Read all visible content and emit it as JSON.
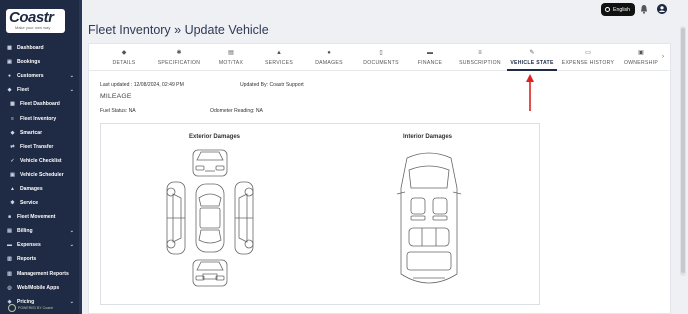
{
  "brand": {
    "logo": "Coastr",
    "tagline": "Make your own way",
    "powered_by": "POWERED BY Coastr"
  },
  "topbar": {
    "language_label": "English"
  },
  "sidebar": {
    "items": [
      {
        "label": "Dashboard",
        "icon": "dashboard-icon",
        "sub": false,
        "chevron": false
      },
      {
        "label": "Bookings",
        "icon": "calendar-icon",
        "sub": false,
        "chevron": false
      },
      {
        "label": "Customers",
        "icon": "users-icon",
        "sub": false,
        "chevron": true
      },
      {
        "label": "Fleet",
        "icon": "car-icon",
        "sub": false,
        "chevron": true
      },
      {
        "label": "Fleet Dashboard",
        "icon": "dashboard-icon",
        "sub": true,
        "chevron": false
      },
      {
        "label": "Fleet Inventory",
        "icon": "list-icon",
        "sub": true,
        "chevron": false
      },
      {
        "label": "Smartcar",
        "icon": "car-icon",
        "sub": true,
        "chevron": false
      },
      {
        "label": "Fleet Transfer",
        "icon": "transfer-icon",
        "sub": true,
        "chevron": false
      },
      {
        "label": "Vehicle Checklist",
        "icon": "check-icon",
        "sub": true,
        "chevron": false
      },
      {
        "label": "Vehicle Scheduler",
        "icon": "calendar-icon",
        "sub": true,
        "chevron": false
      },
      {
        "label": "Damages",
        "icon": "warning-icon",
        "sub": true,
        "chevron": false
      },
      {
        "label": "Service",
        "icon": "wrench-icon",
        "sub": true,
        "chevron": false
      },
      {
        "label": "Fleet Movement",
        "icon": "truck-icon",
        "sub": false,
        "chevron": false
      },
      {
        "label": "Billing",
        "icon": "billing-icon",
        "sub": false,
        "chevron": true
      },
      {
        "label": "Expenses",
        "icon": "wallet-icon",
        "sub": false,
        "chevron": true
      },
      {
        "label": "Reports",
        "icon": "report-icon",
        "sub": false,
        "chevron": false
      },
      {
        "label": "Management Reports",
        "icon": "report-icon",
        "sub": false,
        "chevron": false
      },
      {
        "label": "Web/Mobile Apps",
        "icon": "globe-icon",
        "sub": false,
        "chevron": false
      },
      {
        "label": "Pricing",
        "icon": "tag-icon",
        "sub": false,
        "chevron": true
      }
    ]
  },
  "page": {
    "title": "Fleet Inventory » Update Vehicle"
  },
  "tabs": [
    {
      "label": "DETAILS",
      "icon": "car-icon",
      "active": false
    },
    {
      "label": "SPECIFICATION",
      "icon": "wrench-icon",
      "active": false
    },
    {
      "label": "MOT/TAX",
      "icon": "document-icon",
      "active": false
    },
    {
      "label": "SERVICES",
      "icon": "warning-icon",
      "active": false
    },
    {
      "label": "DAMAGES",
      "icon": "info-icon",
      "active": false
    },
    {
      "label": "DOCUMENTS",
      "icon": "file-icon",
      "active": false
    },
    {
      "label": "FINANCE",
      "icon": "finance-icon",
      "active": false
    },
    {
      "label": "SUBSCRIPTION",
      "icon": "subscription-icon",
      "active": false
    },
    {
      "label": "VEHICLE STATE",
      "icon": "pen-icon",
      "active": true
    },
    {
      "label": "EXPENSE HISTORY",
      "icon": "card-icon",
      "active": false
    },
    {
      "label": "OWNERSHIP",
      "icon": "id-card-icon",
      "active": false
    }
  ],
  "vehicle_state": {
    "last_updated": "Last updated : 12/08/2024, 02:49 PM",
    "updated_by": "Updated By: Coastr Support",
    "section_title": "MILEAGE",
    "fuel_status": "Fuel Status: NA",
    "odometer": "Odometer Reading: NA",
    "exterior_title": "Exterior Damages",
    "interior_title": "Interior Damages"
  },
  "colors": {
    "sidebar_bg": "#1f2a44",
    "accent": "#1f2a44",
    "annotation_arrow": "#e02020"
  }
}
